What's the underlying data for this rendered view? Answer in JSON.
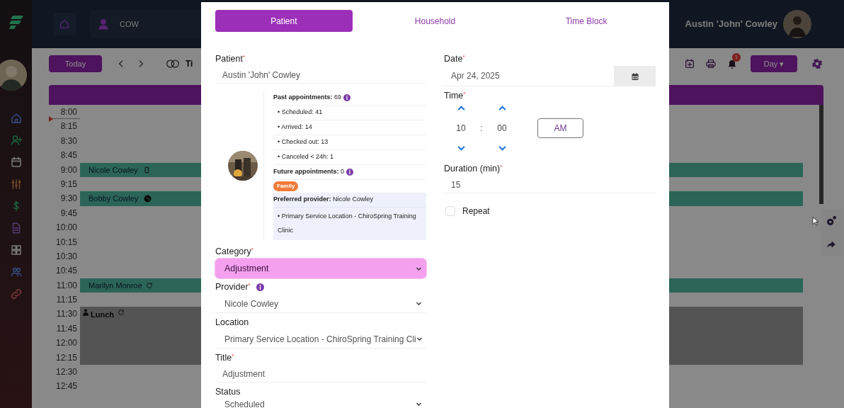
{
  "header": {
    "search_value": "COW",
    "user_name": "Austin 'John' Cowley"
  },
  "toolbar": {
    "today": "Today",
    "title": "Ti",
    "notification_count": "1",
    "view": "Day ▾"
  },
  "calendar": {
    "slots": [
      {
        "time": "8:00"
      },
      {
        "time": "8:15"
      },
      {
        "time": "8:30"
      },
      {
        "time": "8:45"
      },
      {
        "time": "9:00",
        "event": {
          "kind": "appointment",
          "name": "Nicole Cowley"
        }
      },
      {
        "time": "9:15"
      },
      {
        "time": "9:30",
        "event": {
          "kind": "appointment",
          "name": "Bobby Cowley"
        }
      },
      {
        "time": "9:45"
      },
      {
        "time": "10:00"
      },
      {
        "time": "10:15"
      },
      {
        "time": "10:30"
      },
      {
        "time": "10:45"
      },
      {
        "time": "11:00",
        "event": {
          "kind": "appointment",
          "name": "Marilyn Monroe"
        }
      },
      {
        "time": "11:15"
      },
      {
        "time": "11:30",
        "event": {
          "kind": "block",
          "name": "Lunch"
        }
      },
      {
        "time": "11:45",
        "continued": true
      },
      {
        "time": "12:00",
        "continued": true
      },
      {
        "time": "12:15",
        "continued": true
      },
      {
        "time": "12:30"
      },
      {
        "time": "12:45"
      }
    ]
  },
  "modal": {
    "tabs": [
      {
        "label": "Patient",
        "selected": true
      },
      {
        "label": "Household",
        "selected": false
      },
      {
        "label": "Time Block",
        "selected": false
      }
    ],
    "patient": {
      "label": "Patient$^{*}$",
      "value": "Austin 'John' Cowley"
    },
    "summary": {
      "past": "**Past appointments:** 69",
      "past_lines": [
        "• Scheduled: 41",
        "• Arrived: 14",
        "• Checked out: 13",
        "• Canceled < 24h: 1"
      ],
      "future": "**Future appointments:** 0",
      "tag": "Family",
      "preferred": "**Preferred provider:** Nicole Cowley",
      "locations": [
        "• Primary Service Location - ChiroSpring Training Clinic"
      ]
    },
    "category": {
      "label": "Category$^{*}$",
      "value": "Adjustment"
    },
    "provider": {
      "label": "Provider$^{*}$",
      "value": "Nicole Cowley"
    },
    "location": {
      "label": "Location",
      "value": "Primary Service Location - ChiroSpring Training Cli"
    },
    "title": {
      "label": "Title$^{*}$",
      "value": "Adjustment"
    },
    "status": {
      "label": "Status",
      "value": "Scheduled"
    },
    "date": {
      "label": "Date$^{*}$",
      "value": "Apr 24, 2025"
    },
    "time": {
      "label": "Time$^{*}$",
      "hour": "10",
      "separator": ":",
      "minute": "00",
      "period": "AM"
    },
    "duration": {
      "label": "Duration (min)$^{*}$",
      "value": "15"
    },
    "repeat": {
      "label": "Repeat",
      "checked": false
    }
  }
}
